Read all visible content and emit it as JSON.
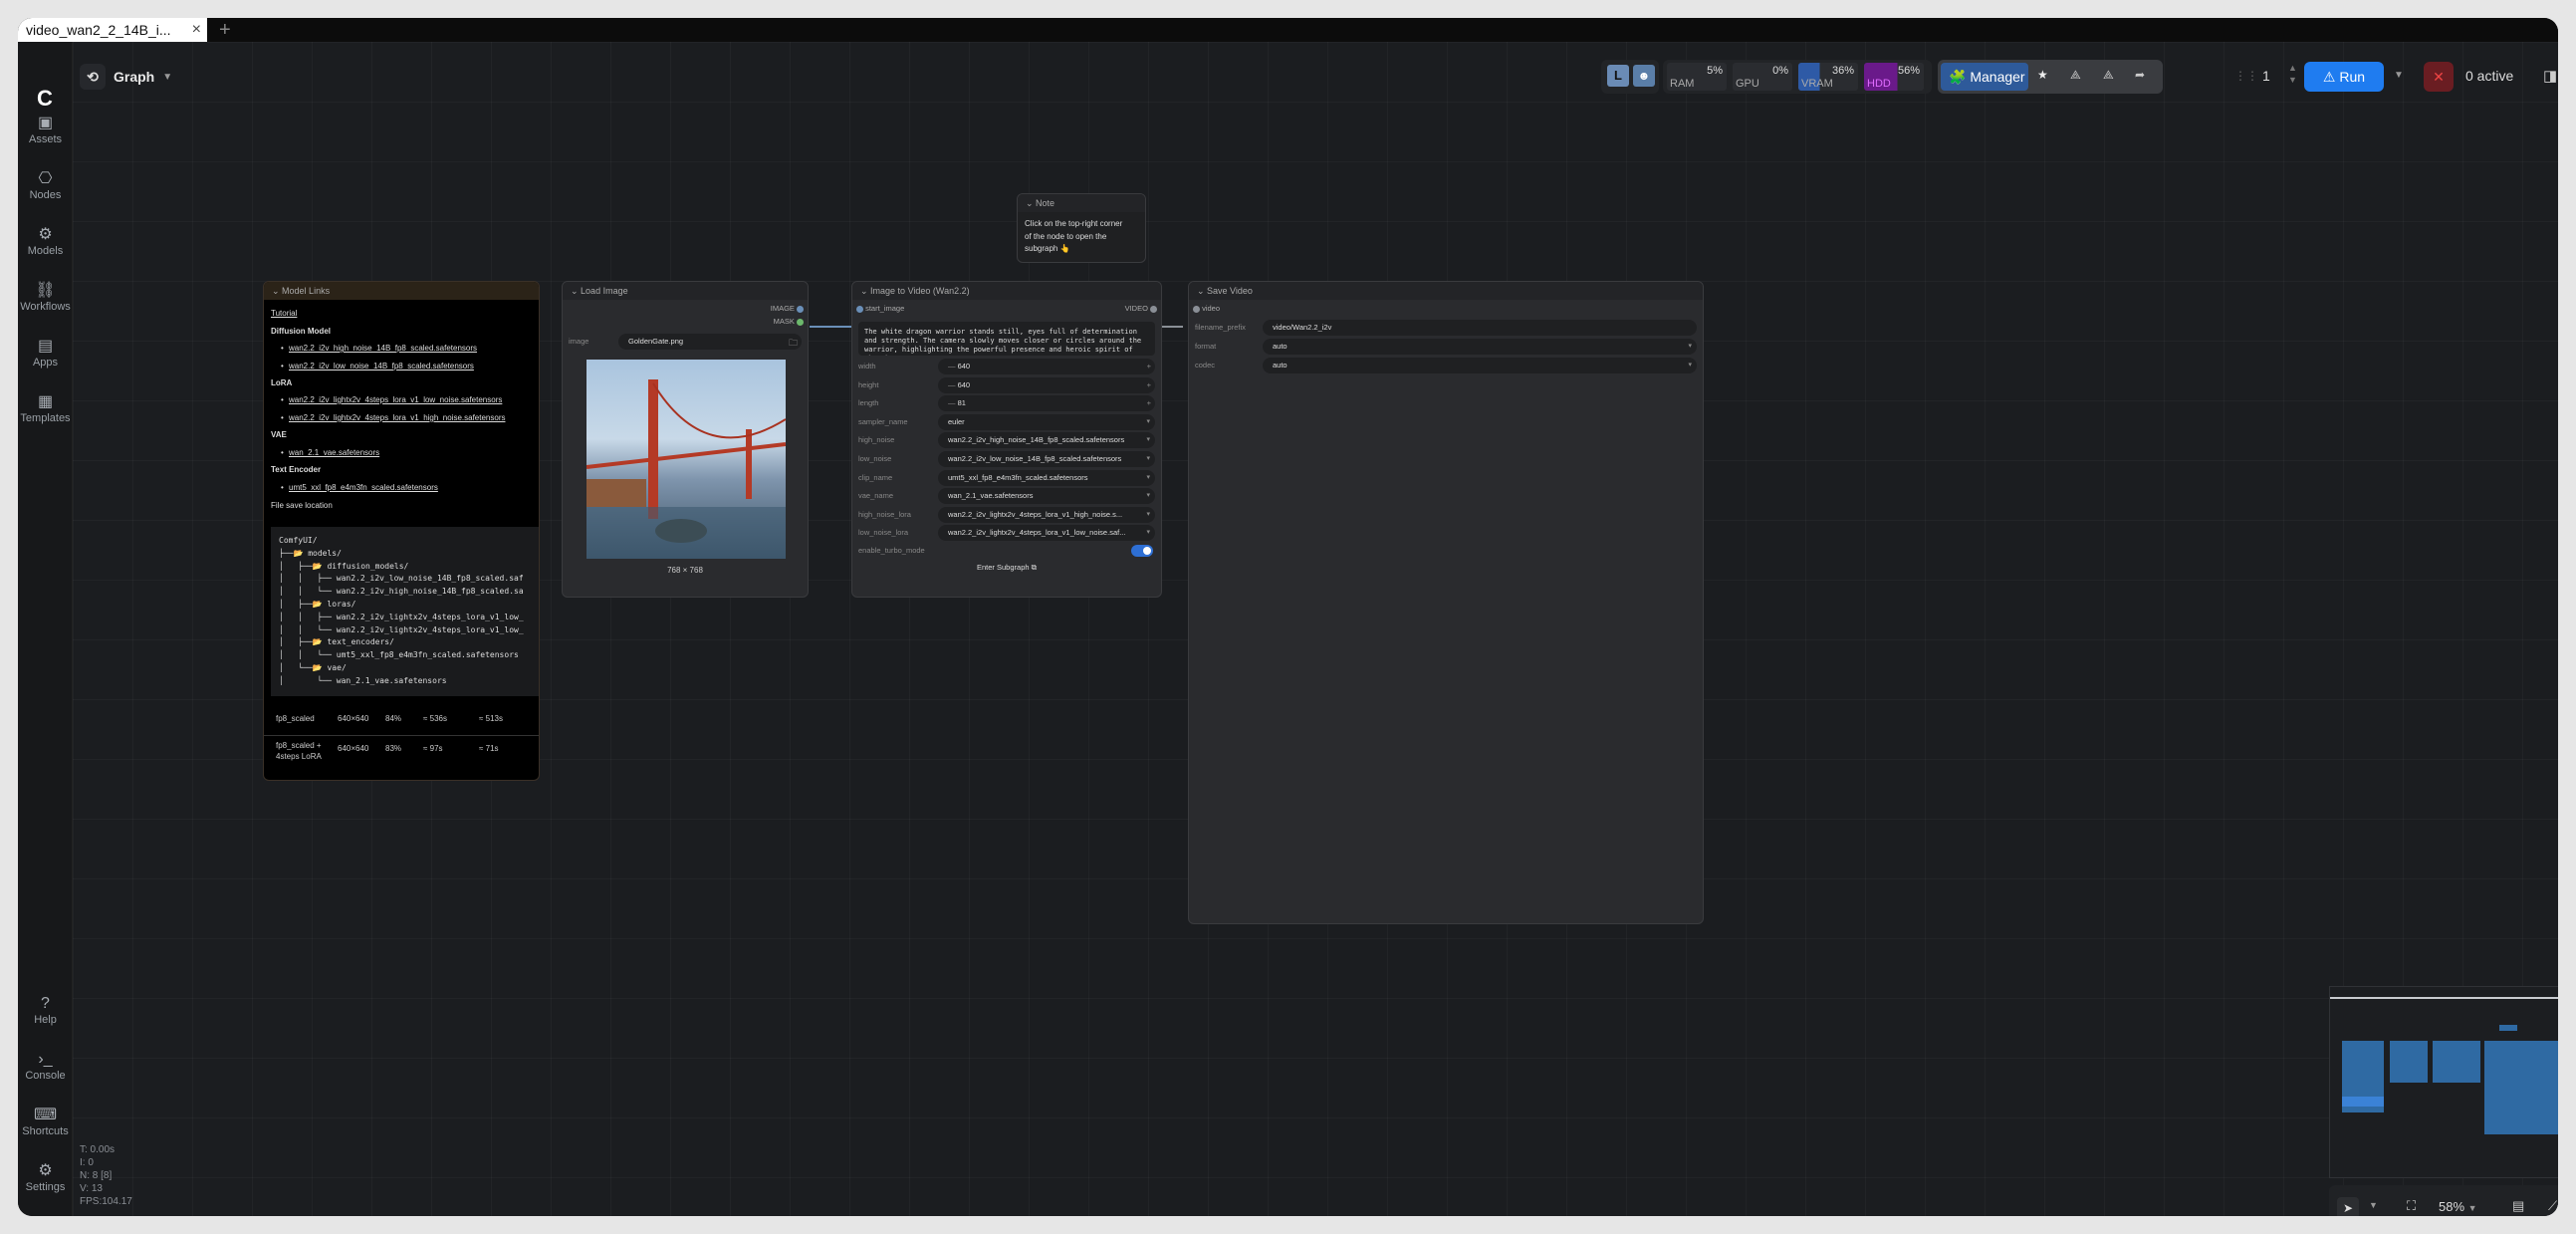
{
  "tab": {
    "title": "video_wan2_2_14B_i...",
    "close": "×",
    "new": "+"
  },
  "header": {
    "graph_label": "Graph"
  },
  "sidebar": {
    "items": [
      {
        "label": "Assets",
        "icon": "assets-icon"
      },
      {
        "label": "Nodes",
        "icon": "nodes-icon"
      },
      {
        "label": "Models",
        "icon": "models-icon"
      },
      {
        "label": "Workflows",
        "icon": "workflows-icon"
      },
      {
        "label": "Apps",
        "icon": "apps-icon"
      },
      {
        "label": "Templates",
        "icon": "templates-icon"
      }
    ],
    "bottom": [
      {
        "label": "Help",
        "icon": "help-icon"
      },
      {
        "label": "Console",
        "icon": "console-icon"
      },
      {
        "label": "Shortcuts",
        "icon": "keyboard-icon"
      },
      {
        "label": "Settings",
        "icon": "gear-icon"
      }
    ]
  },
  "toolbar": {
    "monitors": [
      {
        "label": "RAM",
        "value": "5%"
      },
      {
        "label": "GPU",
        "value": "0%"
      },
      {
        "label": "VRAM",
        "value": "36%"
      },
      {
        "label": "HDD",
        "value": "56%"
      }
    ],
    "manager_label": "Manager",
    "queue_count": "1",
    "run_label": "Run",
    "active_label": "0 active"
  },
  "note_node": {
    "title": "Note",
    "text1": "Click on the top-right corner",
    "text2": "of the node to open the",
    "text3": "subgraph 👆"
  },
  "model_links": {
    "title": "Model Links",
    "tutorial": "Tutorial",
    "diffusion_heading": "Diffusion Model",
    "diffusion": [
      "wan2.2_i2v_high_noise_14B_fp8_scaled.safetensors",
      "wan2.2_i2v_low_noise_14B_fp8_scaled.safetensors"
    ],
    "lora_heading": "LoRA",
    "lora": [
      "wan2.2_i2v_lightx2v_4steps_lora_v1_low_noise.safetensors",
      "wan2.2_i2v_lightx2v_4steps_lora_v1_high_noise.safetensors"
    ],
    "vae_heading": "VAE",
    "vae": [
      "wan_2.1_vae.safetensors"
    ],
    "te_heading": "Text Encoder",
    "te": [
      "umt5_xxl_fp8_e4m3fn_scaled.safetensors"
    ],
    "save_heading": "File save location",
    "tree": "ComfyUI/\n├──📂 models/\n│   ├──📂 diffusion_models/\n│   │   ├── wan2.2_i2v_low_noise_14B_fp8_scaled.saf\n│   │   └── wan2.2_i2v_high_noise_14B_fp8_scaled.sa\n│   ├──📂 loras/\n│   │   ├── wan2.2_i2v_lightx2v_4steps_lora_v1_low_\n│   │   └── wan2.2_i2v_lightx2v_4steps_lora_v1_low_\n│   ├──📂 text_encoders/\n│   │   └── umt5_xxl_fp8_e4m3fn_scaled.safetensors\n│   └──📂 vae/\n│       └── wan_2.1_vae.safetensors",
    "table": [
      [
        "fp8_scaled",
        "640×640",
        "84%",
        "≈ 536s",
        "≈ 513s"
      ],
      [
        "fp8_scaled + 4steps LoRA",
        "640×640",
        "83%",
        "≈ 97s",
        "≈ 71s"
      ]
    ]
  },
  "load_image": {
    "title": "Load Image",
    "out_image": "IMAGE",
    "out_mask": "MASK",
    "widget_label": "image",
    "filename": "GoldenGate.png",
    "size": "768 × 768"
  },
  "i2v": {
    "title": "Image to Video (Wan2.2)",
    "input": "start_image",
    "output": "VIDEO",
    "prompt": "The white dragon warrior stands still, eyes full of determination and strength. The camera slowly moves closer or circles around the warrior, highlighting the powerful presence and heroic spirit of the character.",
    "widgets": [
      {
        "label": "width",
        "value": "640",
        "kind": "num"
      },
      {
        "label": "height",
        "value": "640",
        "kind": "num"
      },
      {
        "label": "length",
        "value": "81",
        "kind": "num"
      },
      {
        "label": "sampler_name",
        "value": "euler",
        "kind": "combo"
      },
      {
        "label": "high_noise",
        "value": "wan2.2_i2v_high_noise_14B_fp8_scaled.safetensors",
        "kind": "combo"
      },
      {
        "label": "low_noise",
        "value": "wan2.2_i2v_low_noise_14B_fp8_scaled.safetensors",
        "kind": "combo"
      },
      {
        "label": "clip_name",
        "value": "umt5_xxl_fp8_e4m3fn_scaled.safetensors",
        "kind": "combo"
      },
      {
        "label": "vae_name",
        "value": "wan_2.1_vae.safetensors",
        "kind": "combo"
      },
      {
        "label": "high_noise_lora",
        "value": "wan2.2_i2v_lightx2v_4steps_lora_v1_high_noise.s...",
        "kind": "combo"
      },
      {
        "label": "low_noise_lora",
        "value": "wan2.2_i2v_lightx2v_4steps_lora_v1_low_noise.saf...",
        "kind": "combo"
      }
    ],
    "turbo_label": "enable_turbo_mode",
    "enter_label": "Enter Subgraph"
  },
  "save_video": {
    "title": "Save Video",
    "input": "video",
    "widgets": [
      {
        "label": "filename_prefix",
        "value": "video/Wan2.2_i2v"
      },
      {
        "label": "format",
        "value": "auto"
      },
      {
        "label": "codec",
        "value": "auto"
      }
    ]
  },
  "zoom": "58%",
  "stats": [
    "T: 0.00s",
    "I: 0",
    "N: 8 [8]",
    "V: 13",
    "FPS:104.17"
  ]
}
